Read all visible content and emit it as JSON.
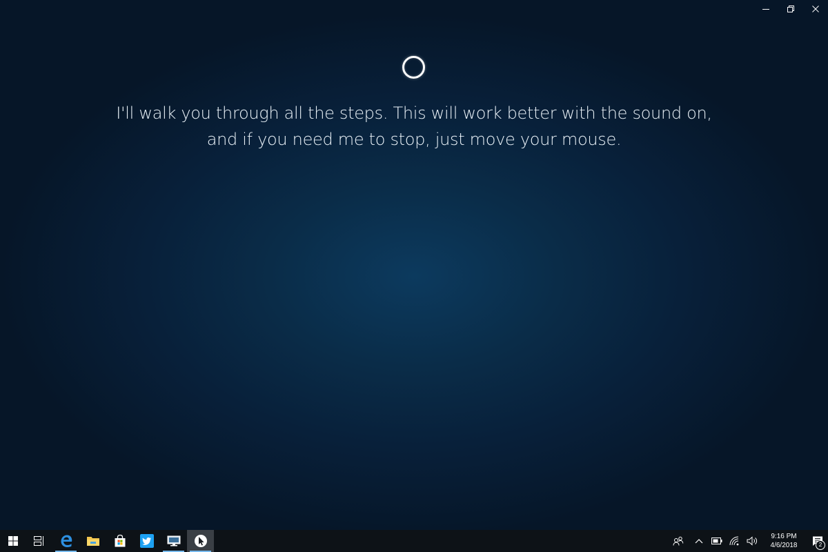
{
  "window": {
    "controls": {
      "minimize_icon": "minimize-icon",
      "restore_icon": "restore-icon",
      "close_icon": "close-icon"
    }
  },
  "main": {
    "indicator": "cortana-ring",
    "message_line_1": "I'll walk you through all the steps. This will work better with the sound on,",
    "message_line_2": "and if you need me to stop, just move your mouse."
  },
  "taskbar": {
    "apps": [
      {
        "name": "start",
        "icon": "windows-logo-icon"
      },
      {
        "name": "task-view",
        "icon": "task-view-icon"
      },
      {
        "name": "edge",
        "icon": "edge-icon"
      },
      {
        "name": "file-explorer",
        "icon": "folder-icon"
      },
      {
        "name": "store",
        "icon": "store-bag-icon"
      },
      {
        "name": "twitter",
        "icon": "twitter-icon"
      },
      {
        "name": "desktop-app",
        "icon": "monitor-icon"
      },
      {
        "name": "pointer-app",
        "icon": "pointer-icon"
      }
    ],
    "tray": {
      "people_icon": "people-icon",
      "chevron_icon": "chevron-up-icon",
      "battery_icon": "battery-icon",
      "wifi_icon": "wifi-icon",
      "volume_icon": "volume-icon",
      "time": "9:16 PM",
      "date": "4/6/2018",
      "notification_count": "2"
    }
  },
  "colors": {
    "background_center": "#0c3a5e",
    "background_edge": "#061628",
    "taskbar": "#0d1217",
    "accent": "#76b9ed"
  }
}
